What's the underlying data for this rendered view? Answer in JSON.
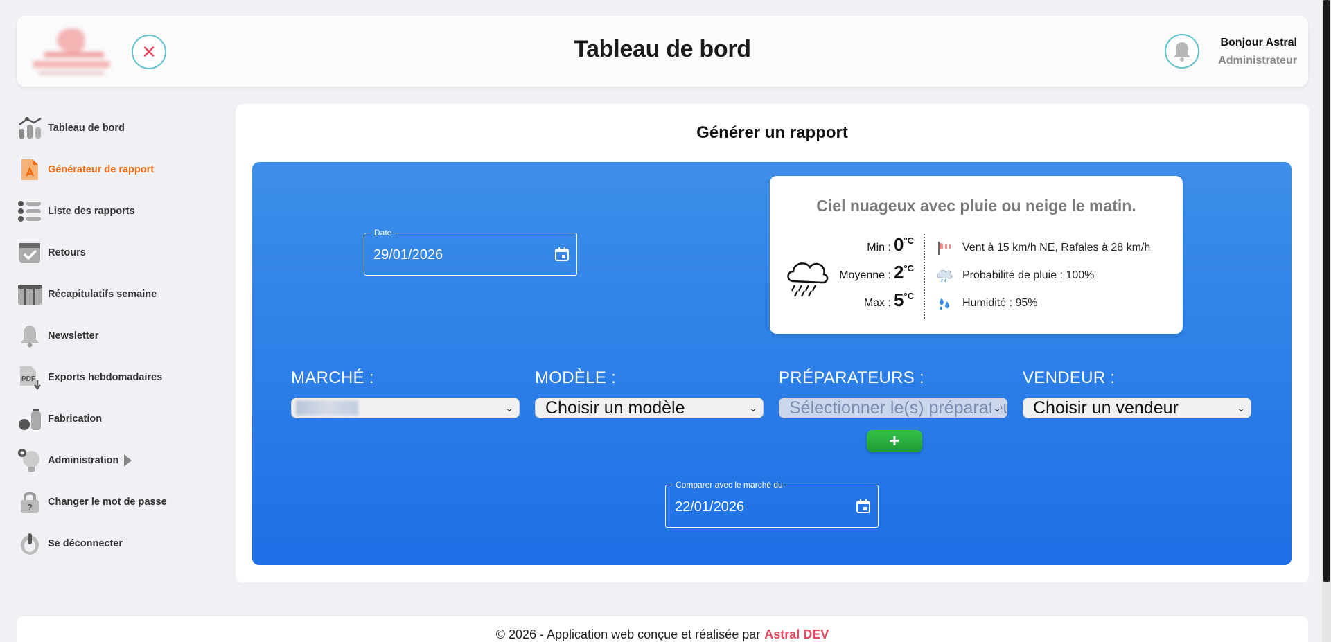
{
  "header": {
    "title": "Tableau de bord",
    "close_symbol": "✕",
    "user_greeting": "Bonjour Astral",
    "user_role": "Administrateur"
  },
  "sidebar": {
    "items": [
      {
        "label": "Tableau de bord",
        "icon": "dashboard-icon",
        "active": false
      },
      {
        "label": "Générateur de rapport",
        "icon": "pdf-file-icon",
        "active": true
      },
      {
        "label": "Liste des rapports",
        "icon": "list-icon",
        "active": false
      },
      {
        "label": "Retours",
        "icon": "checkbox-icon",
        "active": false
      },
      {
        "label": "Récapitulatifs semaine",
        "icon": "columns-icon",
        "active": false
      },
      {
        "label": "Newsletter",
        "icon": "bell-icon",
        "active": false
      },
      {
        "label": "Exports hebdomadaires",
        "icon": "pdf-download-icon",
        "active": false
      },
      {
        "label": "Fabrication",
        "icon": "flask-icon",
        "active": false
      },
      {
        "label": "Administration",
        "icon": "lightbulb-gear-icon",
        "active": false
      },
      {
        "label": "Changer le mot de passe",
        "icon": "lock-icon",
        "active": false
      },
      {
        "label": "Se déconnecter",
        "icon": "power-icon",
        "active": false
      }
    ]
  },
  "main": {
    "title": "Générer un rapport",
    "date": {
      "legend": "Date",
      "value": "29/01/2026"
    },
    "compare_date": {
      "legend": "Comparer avec le marché du",
      "value": "22/01/2026"
    },
    "weather": {
      "title": "Ciel nuageux avec pluie ou neige le matin.",
      "min_label": "Min :",
      "min_value": "0",
      "unit": "°C",
      "avg_label": "Moyenne :",
      "avg_value": "2",
      "max_label": "Max :",
      "max_value": "5",
      "wind": "Vent à 15 km/h NE, Rafales à 28 km/h",
      "rain": "Probabilité de pluie : 100%",
      "humidity": "Humidité : 95%"
    },
    "selects": {
      "marche_label": "MARCHÉ :",
      "modele_label": "MODÈLE :",
      "modele_value": "Choisir un modèle",
      "preparateurs_label": "PRÉPARATEURS :",
      "preparateurs_placeholder": "Sélectionner le(s) préparateur(s)",
      "vendeur_label": "VENDEUR :",
      "vendeur_value": "Choisir un vendeur"
    },
    "add_symbol": "+"
  },
  "footer": {
    "text": "© 2026 - Application web conçue et réalisée par",
    "brand": "Astral DEV"
  },
  "colors": {
    "accent_orange": "#ef6c12",
    "brand_red": "#e5495f",
    "panel_blue": "#1e6fe6",
    "add_green": "#1f9b30"
  }
}
